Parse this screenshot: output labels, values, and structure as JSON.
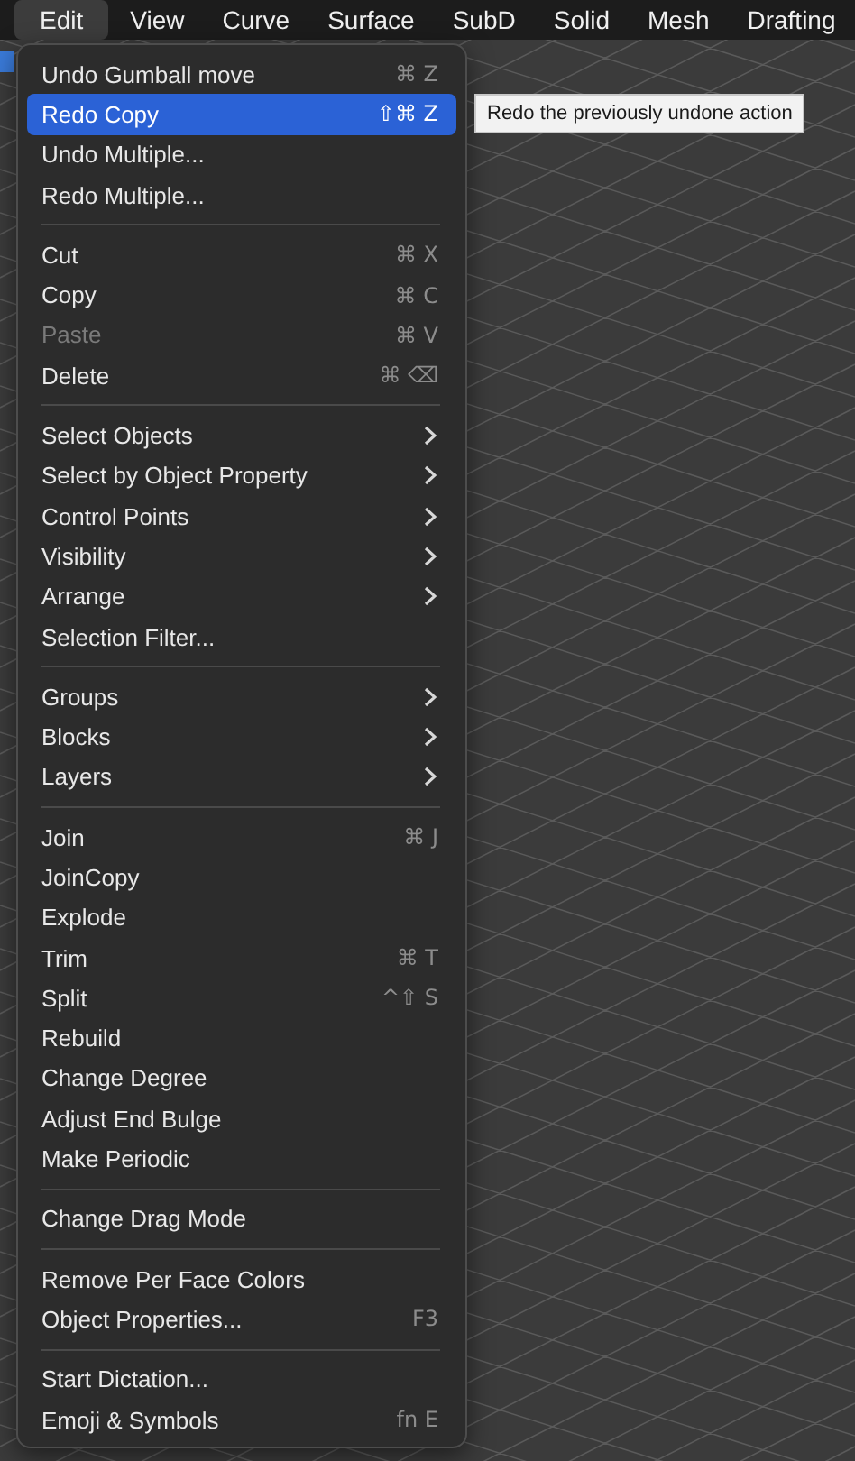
{
  "menu_bar": {
    "items": [
      {
        "label": "Edit",
        "selected": true
      },
      {
        "label": "View",
        "selected": false
      },
      {
        "label": "Curve",
        "selected": false
      },
      {
        "label": "Surface",
        "selected": false
      },
      {
        "label": "SubD",
        "selected": false
      },
      {
        "label": "Solid",
        "selected": false
      },
      {
        "label": "Mesh",
        "selected": false
      },
      {
        "label": "Drafting",
        "selected": false
      }
    ]
  },
  "menu": {
    "sections": [
      {
        "items": [
          {
            "label": "Undo Gumball move",
            "shortcut": "⌘ Z",
            "kind": "command",
            "selected": false,
            "disabled": false
          },
          {
            "label": "Redo Copy",
            "shortcut": "⇧⌘ Z",
            "kind": "command",
            "selected": true,
            "disabled": false
          },
          {
            "label": "Undo Multiple...",
            "kind": "command",
            "selected": false,
            "disabled": false
          },
          {
            "label": "Redo Multiple...",
            "kind": "command",
            "selected": false,
            "disabled": false
          }
        ]
      },
      {
        "items": [
          {
            "label": "Cut",
            "shortcut": "⌘ X",
            "kind": "command",
            "selected": false,
            "disabled": false
          },
          {
            "label": "Copy",
            "shortcut": "⌘ C",
            "kind": "command",
            "selected": false,
            "disabled": false
          },
          {
            "label": "Paste",
            "shortcut": "⌘ V",
            "kind": "command",
            "selected": false,
            "disabled": true
          },
          {
            "label": "Delete",
            "shortcut": "⌘ ⌫",
            "kind": "command",
            "selected": false,
            "disabled": false
          }
        ]
      },
      {
        "items": [
          {
            "label": "Select Objects",
            "kind": "submenu",
            "selected": false,
            "disabled": false
          },
          {
            "label": "Select by Object Property",
            "kind": "submenu",
            "selected": false,
            "disabled": false
          },
          {
            "label": "Control Points",
            "kind": "submenu",
            "selected": false,
            "disabled": false
          },
          {
            "label": "Visibility",
            "kind": "submenu",
            "selected": false,
            "disabled": false
          },
          {
            "label": "Arrange",
            "kind": "submenu",
            "selected": false,
            "disabled": false
          },
          {
            "label": "Selection Filter...",
            "kind": "command",
            "selected": false,
            "disabled": false
          }
        ]
      },
      {
        "items": [
          {
            "label": "Groups",
            "kind": "submenu",
            "selected": false,
            "disabled": false
          },
          {
            "label": "Blocks",
            "kind": "submenu",
            "selected": false,
            "disabled": false
          },
          {
            "label": "Layers",
            "kind": "submenu",
            "selected": false,
            "disabled": false
          }
        ]
      },
      {
        "items": [
          {
            "label": "Join",
            "shortcut": "⌘ J",
            "kind": "command",
            "selected": false,
            "disabled": false
          },
          {
            "label": "JoinCopy",
            "kind": "command",
            "selected": false,
            "disabled": false
          },
          {
            "label": "Explode",
            "kind": "command",
            "selected": false,
            "disabled": false
          },
          {
            "label": "Trim",
            "shortcut": "⌘ T",
            "kind": "command",
            "selected": false,
            "disabled": false
          },
          {
            "label": "Split",
            "shortcut": "^⇧ S",
            "kind": "command",
            "selected": false,
            "disabled": false
          },
          {
            "label": "Rebuild",
            "kind": "command",
            "selected": false,
            "disabled": false
          },
          {
            "label": "Change Degree",
            "kind": "command",
            "selected": false,
            "disabled": false
          },
          {
            "label": "Adjust End Bulge",
            "kind": "command",
            "selected": false,
            "disabled": false
          },
          {
            "label": "Make Periodic",
            "kind": "command",
            "selected": false,
            "disabled": false
          }
        ]
      },
      {
        "items": [
          {
            "label": "Change Drag Mode",
            "kind": "command",
            "selected": false,
            "disabled": false
          }
        ]
      },
      {
        "items": [
          {
            "label": "Remove Per Face Colors",
            "kind": "command",
            "selected": false,
            "disabled": false
          },
          {
            "label": "Object Properties...",
            "shortcut": "F3",
            "kind": "command",
            "selected": false,
            "disabled": false
          }
        ]
      },
      {
        "items": [
          {
            "label": "Start Dictation...",
            "kind": "command",
            "selected": false,
            "disabled": false
          },
          {
            "label": "Emoji & Symbols",
            "shortcut": "fn E",
            "kind": "command",
            "selected": false,
            "disabled": false
          }
        ]
      }
    ]
  },
  "tooltip": {
    "text": "Redo the previously undone action"
  }
}
